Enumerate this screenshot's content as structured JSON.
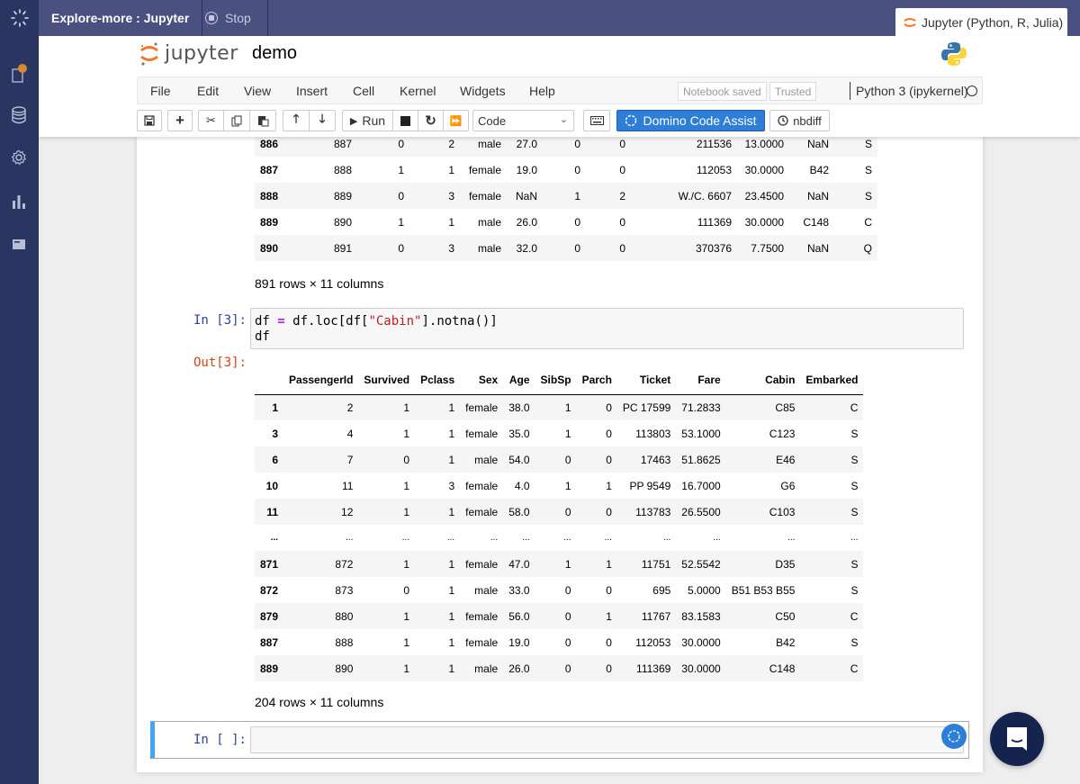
{
  "topbar": {
    "app_title": "Explore-more : Jupyter",
    "stop_label": "Stop",
    "env_tab_label": "Jupyter (Python, R, Julia)"
  },
  "sidebar": {
    "items": [
      {
        "name": "files-icon",
        "has_badge": true
      },
      {
        "name": "data-icon"
      },
      {
        "name": "settings-icon"
      },
      {
        "name": "charts-icon"
      },
      {
        "name": "card-icon"
      }
    ]
  },
  "header": {
    "logo_text": "jupyter",
    "notebook_name": "demo"
  },
  "menu": {
    "items": [
      "File",
      "Edit",
      "View",
      "Insert",
      "Cell",
      "Kernel",
      "Widgets",
      "Help"
    ],
    "notebook_status": "Notebook saved",
    "trusted": "Trusted",
    "kernel": "Python 3 (ipykernel)"
  },
  "toolbar": {
    "run_label": "Run",
    "cell_type": "Code",
    "code_assist_label": "Domino Code Assist",
    "nbdiff_label": "nbdiff"
  },
  "output1": {
    "rows": [
      [
        "886",
        "887",
        "0",
        "2",
        "male",
        "27.0",
        "0",
        "0",
        "211536",
        "13.0000",
        "NaN",
        "S"
      ],
      [
        "887",
        "888",
        "1",
        "1",
        "female",
        "19.0",
        "0",
        "0",
        "112053",
        "30.0000",
        "B42",
        "S"
      ],
      [
        "888",
        "889",
        "0",
        "3",
        "female",
        "NaN",
        "1",
        "2",
        "W./C. 6607",
        "23.4500",
        "NaN",
        "S"
      ],
      [
        "889",
        "890",
        "1",
        "1",
        "male",
        "26.0",
        "0",
        "0",
        "111369",
        "30.0000",
        "C148",
        "C"
      ],
      [
        "890",
        "891",
        "0",
        "3",
        "male",
        "32.0",
        "0",
        "0",
        "370376",
        "7.7500",
        "NaN",
        "Q"
      ]
    ],
    "shape": "891 rows × 11 columns"
  },
  "cell3": {
    "in_prompt": "In [3]:",
    "code_line1_a": "df ",
    "code_line1_op": "=",
    "code_line1_b": " df.loc[df[",
    "code_line1_str": "\"Cabin\"",
    "code_line1_c": "].notna()]",
    "code_line2": "df",
    "out_prompt": "Out[3]:",
    "columns": [
      "",
      "PassengerId",
      "Survived",
      "Pclass",
      "Sex",
      "Age",
      "SibSp",
      "Parch",
      "Ticket",
      "Fare",
      "Cabin",
      "Embarked"
    ],
    "rows": [
      [
        "1",
        "2",
        "1",
        "1",
        "female",
        "38.0",
        "1",
        "0",
        "PC 17599",
        "71.2833",
        "C85",
        "C"
      ],
      [
        "3",
        "4",
        "1",
        "1",
        "female",
        "35.0",
        "1",
        "0",
        "113803",
        "53.1000",
        "C123",
        "S"
      ],
      [
        "6",
        "7",
        "0",
        "1",
        "male",
        "54.0",
        "0",
        "0",
        "17463",
        "51.8625",
        "E46",
        "S"
      ],
      [
        "10",
        "11",
        "1",
        "3",
        "female",
        "4.0",
        "1",
        "1",
        "PP 9549",
        "16.7000",
        "G6",
        "S"
      ],
      [
        "11",
        "12",
        "1",
        "1",
        "female",
        "58.0",
        "0",
        "0",
        "113783",
        "26.5500",
        "C103",
        "S"
      ],
      [
        "...",
        "...",
        "...",
        "...",
        "...",
        "...",
        "...",
        "...",
        "...",
        "...",
        "...",
        "..."
      ],
      [
        "871",
        "872",
        "1",
        "1",
        "female",
        "47.0",
        "1",
        "1",
        "11751",
        "52.5542",
        "D35",
        "S"
      ],
      [
        "872",
        "873",
        "0",
        "1",
        "male",
        "33.0",
        "0",
        "0",
        "695",
        "5.0000",
        "B51 B53 B55",
        "S"
      ],
      [
        "879",
        "880",
        "1",
        "1",
        "female",
        "56.0",
        "0",
        "1",
        "11767",
        "83.1583",
        "C50",
        "C"
      ],
      [
        "887",
        "888",
        "1",
        "1",
        "female",
        "19.0",
        "0",
        "0",
        "112053",
        "30.0000",
        "B42",
        "S"
      ],
      [
        "889",
        "890",
        "1",
        "1",
        "male",
        "26.0",
        "0",
        "0",
        "111369",
        "30.0000",
        "C148",
        "C"
      ]
    ],
    "shape": "204 rows × 11 columns"
  },
  "empty_cell": {
    "in_prompt": "In [ ]:",
    "value": ""
  },
  "colors": {
    "topbar": "#4a5080",
    "sidebar": "#2a3562",
    "accent_blue": "#2d7ed6",
    "selected_cell": "#42a5f5",
    "chat": "#15234f",
    "badge": "#d9892b"
  }
}
